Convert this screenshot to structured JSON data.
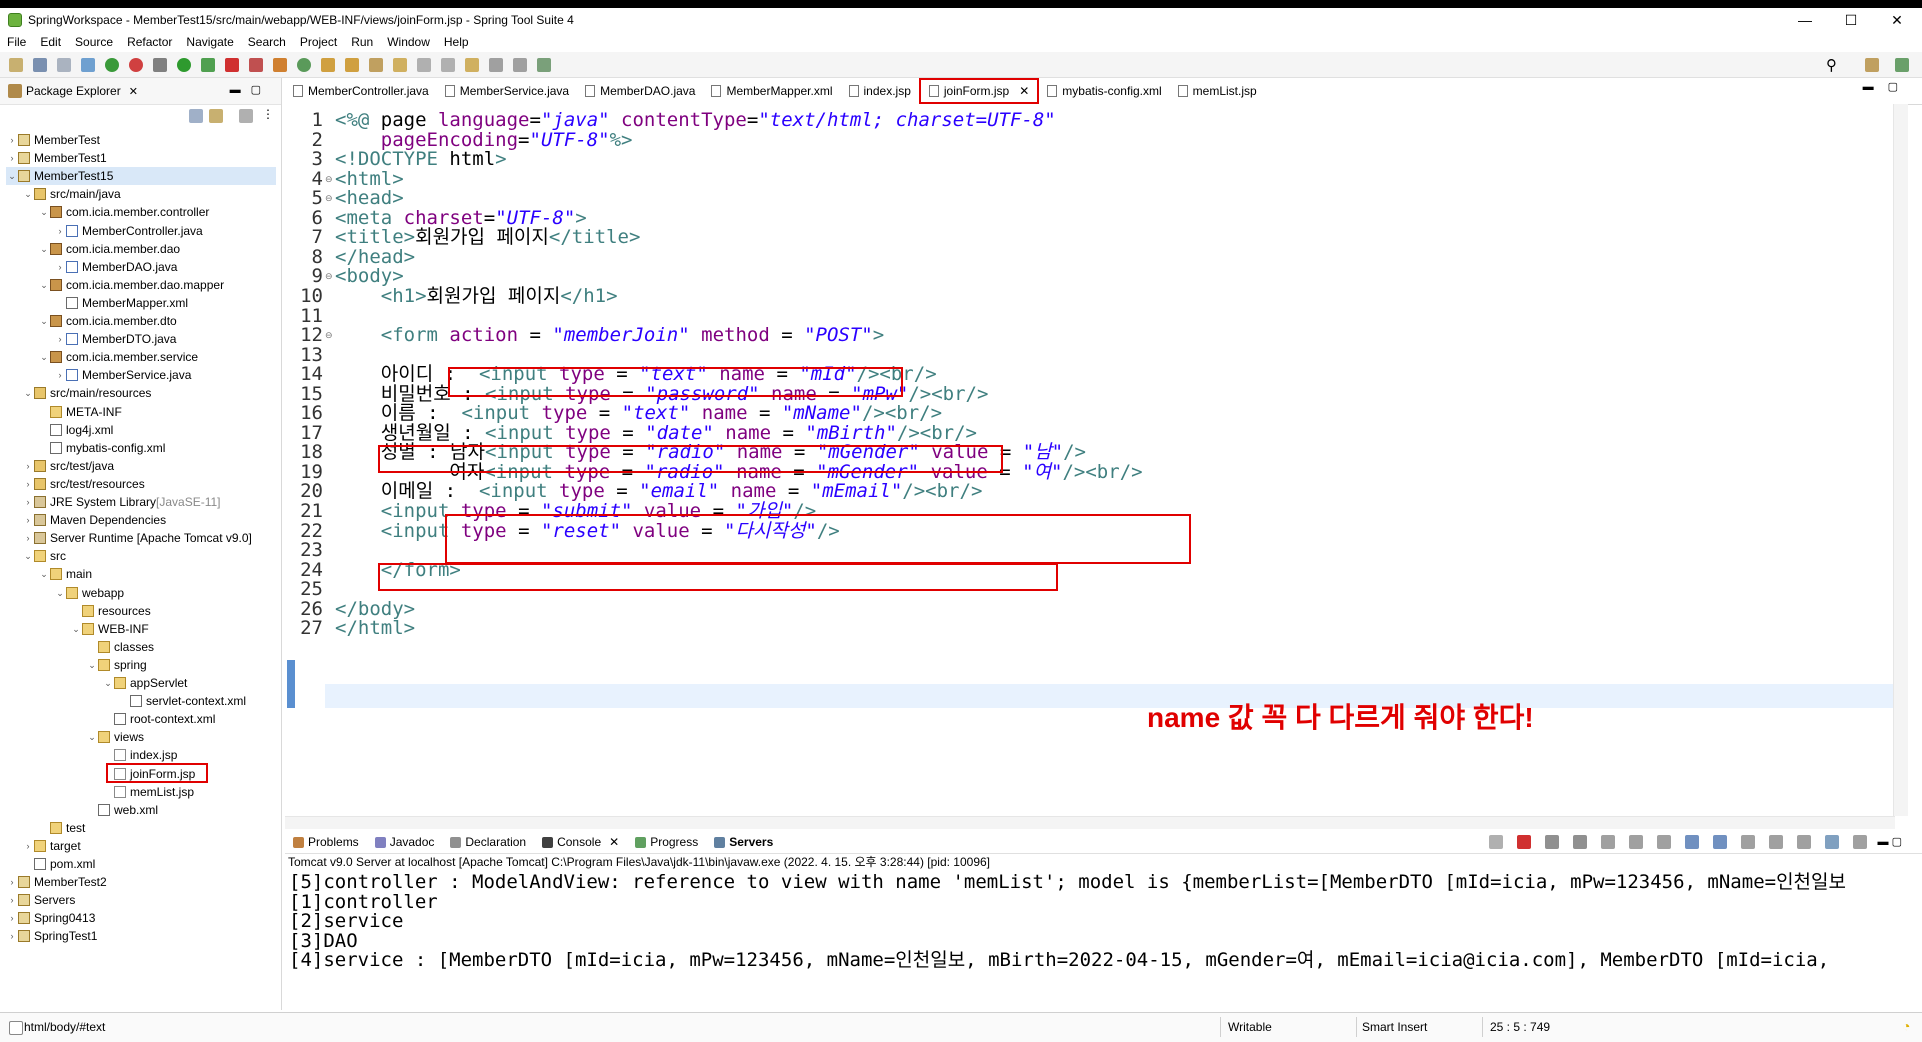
{
  "window": {
    "title": "SpringWorkspace - MemberTest15/src/main/webapp/WEB-INF/views/joinForm.jsp - Spring Tool Suite 4",
    "minimize": "—",
    "maximize": "☐",
    "close": "✕"
  },
  "menu": [
    "File",
    "Edit",
    "Source",
    "Refactor",
    "Navigate",
    "Search",
    "Project",
    "Run",
    "Window",
    "Help"
  ],
  "explorer": {
    "tab_label": "Package Explorer",
    "items": [
      {
        "label": "MemberTest"
      },
      {
        "label": "MemberTest1"
      },
      {
        "label": "MemberTest15"
      },
      {
        "label": "src/main/java"
      },
      {
        "label": "com.icia.member.controller"
      },
      {
        "label": "MemberController.java"
      },
      {
        "label": "com.icia.member.dao"
      },
      {
        "label": "MemberDAO.java"
      },
      {
        "label": "com.icia.member.dao.mapper"
      },
      {
        "label": "MemberMapper.xml"
      },
      {
        "label": "com.icia.member.dto"
      },
      {
        "label": "MemberDTO.java"
      },
      {
        "label": "com.icia.member.service"
      },
      {
        "label": "MemberService.java"
      },
      {
        "label": "src/main/resources"
      },
      {
        "label": "META-INF"
      },
      {
        "label": "log4j.xml"
      },
      {
        "label": "mybatis-config.xml"
      },
      {
        "label": "src/test/java"
      },
      {
        "label": "src/test/resources"
      },
      {
        "label": "JRE System Library",
        "suffix": "[JavaSE-11]"
      },
      {
        "label": "Maven Dependencies"
      },
      {
        "label": "Server Runtime [Apache Tomcat v9.0]"
      },
      {
        "label": "src"
      },
      {
        "label": "main"
      },
      {
        "label": "webapp"
      },
      {
        "label": "resources"
      },
      {
        "label": "WEB-INF"
      },
      {
        "label": "classes"
      },
      {
        "label": "spring"
      },
      {
        "label": "appServlet"
      },
      {
        "label": "servlet-context.xml"
      },
      {
        "label": "root-context.xml"
      },
      {
        "label": "views"
      },
      {
        "label": "index.jsp"
      },
      {
        "label": "joinForm.jsp"
      },
      {
        "label": "memList.jsp"
      },
      {
        "label": "web.xml"
      },
      {
        "label": "test"
      },
      {
        "label": "target"
      },
      {
        "label": "pom.xml"
      },
      {
        "label": "MemberTest2"
      },
      {
        "label": "Servers"
      },
      {
        "label": "Spring0413"
      },
      {
        "label": "SpringTest1"
      }
    ]
  },
  "editor_tabs": [
    "MemberController.java",
    "MemberService.java",
    "MemberDAO.java",
    "MemberMapper.xml",
    "index.jsp",
    "joinForm.jsp",
    "mybatis-config.xml",
    "memList.jsp"
  ],
  "code": {
    "line_numbers": [
      "1",
      "2",
      "3",
      "4",
      "5",
      "6",
      "7",
      "8",
      "9",
      "10",
      "11",
      "12",
      "13",
      "14",
      "15",
      "16",
      "17",
      "18",
      "19",
      "20",
      "21",
      "22",
      "23",
      "24",
      "25",
      "26",
      "27"
    ],
    "lines": [
      "<%@ page language=\"java\" contentType=\"text/html; charset=UTF-8\"",
      "    pageEncoding=\"UTF-8\"%>",
      "<!DOCTYPE html>",
      "<html>",
      "<head>",
      "<meta charset=\"UTF-8\">",
      "<title>회원가입 페이지</title>",
      "</head>",
      "<body>",
      "    <h1>회원가입 페이지</h1>",
      "",
      "    <form action = \"memberJoin\" method = \"POST\">",
      "",
      "    아이디 :  <input type = \"text\" name = \"mId\"/><br/>",
      "    비밀번호 : <input type = \"password\" name = \"mPw\"/><br/>",
      "    이름 :  <input type = \"text\" name = \"mName\"/><br/>",
      "    생년월일 : <input type = \"date\" name = \"mBirth\"/><br/>",
      "    성별 : 남자<input type = \"radio\" name = \"mGender\" value = \"남\"/>",
      "          여자<input type = \"radio\" name = \"mGender\" value = \"여\"/><br/>",
      "    이메일 :  <input type = \"email\" name = \"mEmail\"/><br/>",
      "    <input type = \"submit\" value = \"가입\"/>",
      "    <input type = \"reset\" value = \"다시작성\"/>",
      "",
      "    </form>",
      "",
      "</body>",
      "</html>"
    ],
    "annotation": "name 값 꼭 다 다르게 줘야 한다!"
  },
  "console": {
    "tabs": [
      "Problems",
      "Javadoc",
      "Declaration",
      "Console",
      "Progress",
      "Servers"
    ],
    "description": "Tomcat v9.0 Server at localhost [Apache Tomcat] C:\\Program Files\\Java\\jdk-11\\bin\\javaw.exe  (2022. 4. 15. 오후 3:28:44) [pid: 10096]",
    "lines": [
      "[5]controller : ModelAndView: reference to view with name 'memList'; model is {memberList=[MemberDTO [mId=icia, mPw=123456, mName=인천일보",
      "[1]controller",
      "[2]service",
      "[3]DAO",
      "[4]service : [MemberDTO [mId=icia, mPw=123456, mName=인천일보, mBirth=2022-04-15, mGender=여, mEmail=icia@icia.com], MemberDTO [mId=icia,"
    ]
  },
  "status": {
    "path": "html/body/#text",
    "writable": "Writable",
    "insert_mode": "Smart Insert",
    "position": "25 : 5 : 749"
  }
}
